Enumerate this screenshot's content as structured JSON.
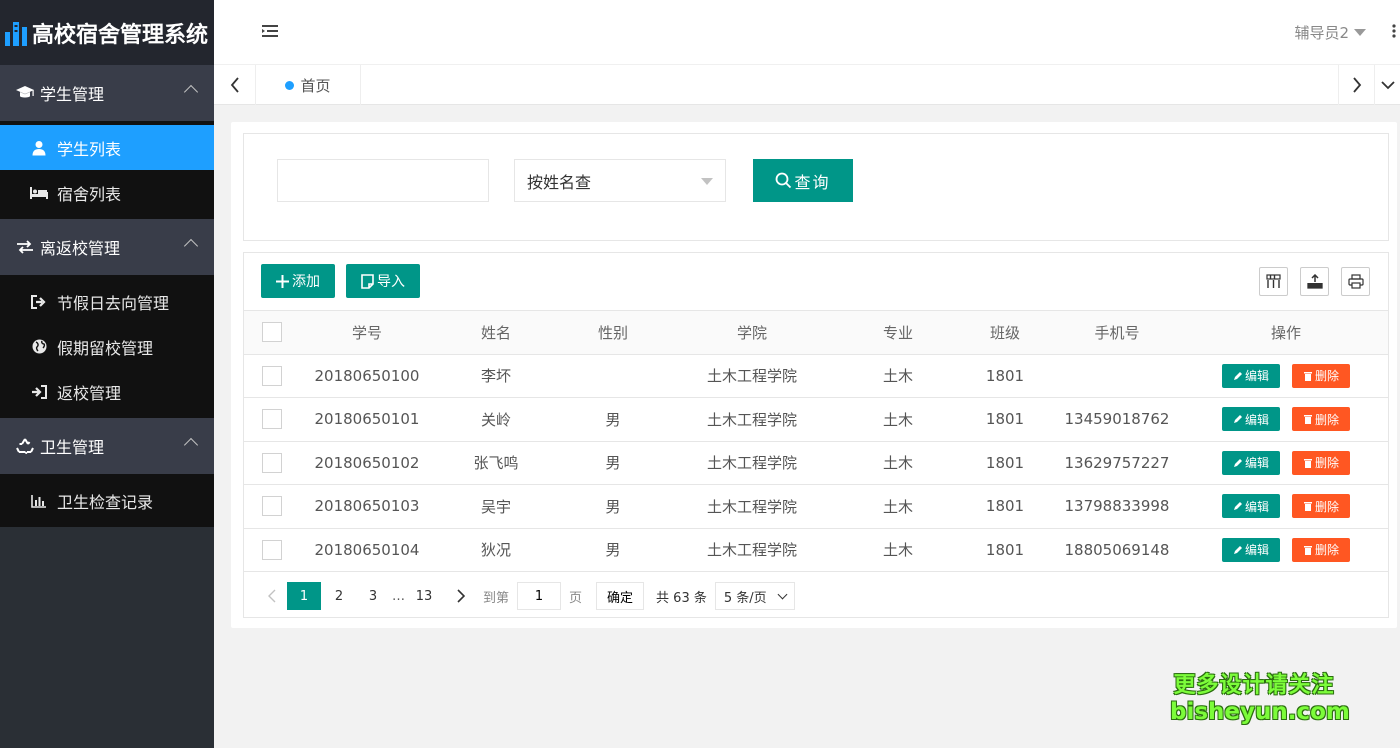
{
  "app": {
    "title": "高校宿舍管理系统"
  },
  "header": {
    "user": "辅导员2"
  },
  "sidebar": {
    "groups": [
      {
        "title": "学生管理",
        "icon": "graduation-cap-icon",
        "items": [
          {
            "label": "学生列表",
            "icon": "user-icon",
            "active": true
          },
          {
            "label": "宿舍列表",
            "icon": "bed-icon"
          }
        ]
      },
      {
        "title": "离返校管理",
        "icon": "exchange-icon",
        "items": [
          {
            "label": "节假日去向管理",
            "icon": "sign-out-icon"
          },
          {
            "label": "假期留校管理",
            "icon": "globe-icon"
          },
          {
            "label": "返校管理",
            "icon": "sign-in-icon"
          }
        ]
      },
      {
        "title": "卫生管理",
        "icon": "recycle-icon",
        "items": [
          {
            "label": "卫生检查记录",
            "icon": "bar-chart-icon"
          }
        ]
      }
    ]
  },
  "tabs": {
    "home": "首页"
  },
  "search": {
    "value": "",
    "select_value": "按姓名查",
    "button": "查询"
  },
  "toolbar": {
    "add": "添加",
    "import": "导入"
  },
  "table": {
    "columns": [
      "学号",
      "姓名",
      "性别",
      "学院",
      "专业",
      "班级",
      "手机号",
      "操作"
    ],
    "rows": [
      {
        "id": "20180650100",
        "name": "李坏",
        "gender": "",
        "college": "土木工程学院",
        "major": "土木",
        "class": "1801",
        "phone": ""
      },
      {
        "id": "20180650101",
        "name": "关岭",
        "gender": "男",
        "college": "土木工程学院",
        "major": "土木",
        "class": "1801",
        "phone": "13459018762"
      },
      {
        "id": "20180650102",
        "name": "张飞鸣",
        "gender": "男",
        "college": "土木工程学院",
        "major": "土木",
        "class": "1801",
        "phone": "13629757227"
      },
      {
        "id": "20180650103",
        "name": "吴宇",
        "gender": "男",
        "college": "土木工程学院",
        "major": "土木",
        "class": "1801",
        "phone": "13798833998"
      },
      {
        "id": "20180650104",
        "name": "狄况",
        "gender": "男",
        "college": "土木工程学院",
        "major": "土木",
        "class": "1801",
        "phone": "18805069148"
      }
    ],
    "edit": "编辑",
    "delete": "删除"
  },
  "pager": {
    "pages": [
      "1",
      "2",
      "3"
    ],
    "ellipsis": "…",
    "last": "13",
    "goto_label": "到第",
    "goto_value": "1",
    "page_unit": "页",
    "confirm": "确定",
    "total": "共 63 条",
    "size": "5 条/页"
  },
  "watermark": {
    "line1": "更多设计请关注",
    "line2": "bisheyun.com"
  },
  "colors": {
    "primary": "#009688",
    "danger": "#ff5722",
    "active": "#1e9fff",
    "sidebar": "#2a2f35"
  }
}
